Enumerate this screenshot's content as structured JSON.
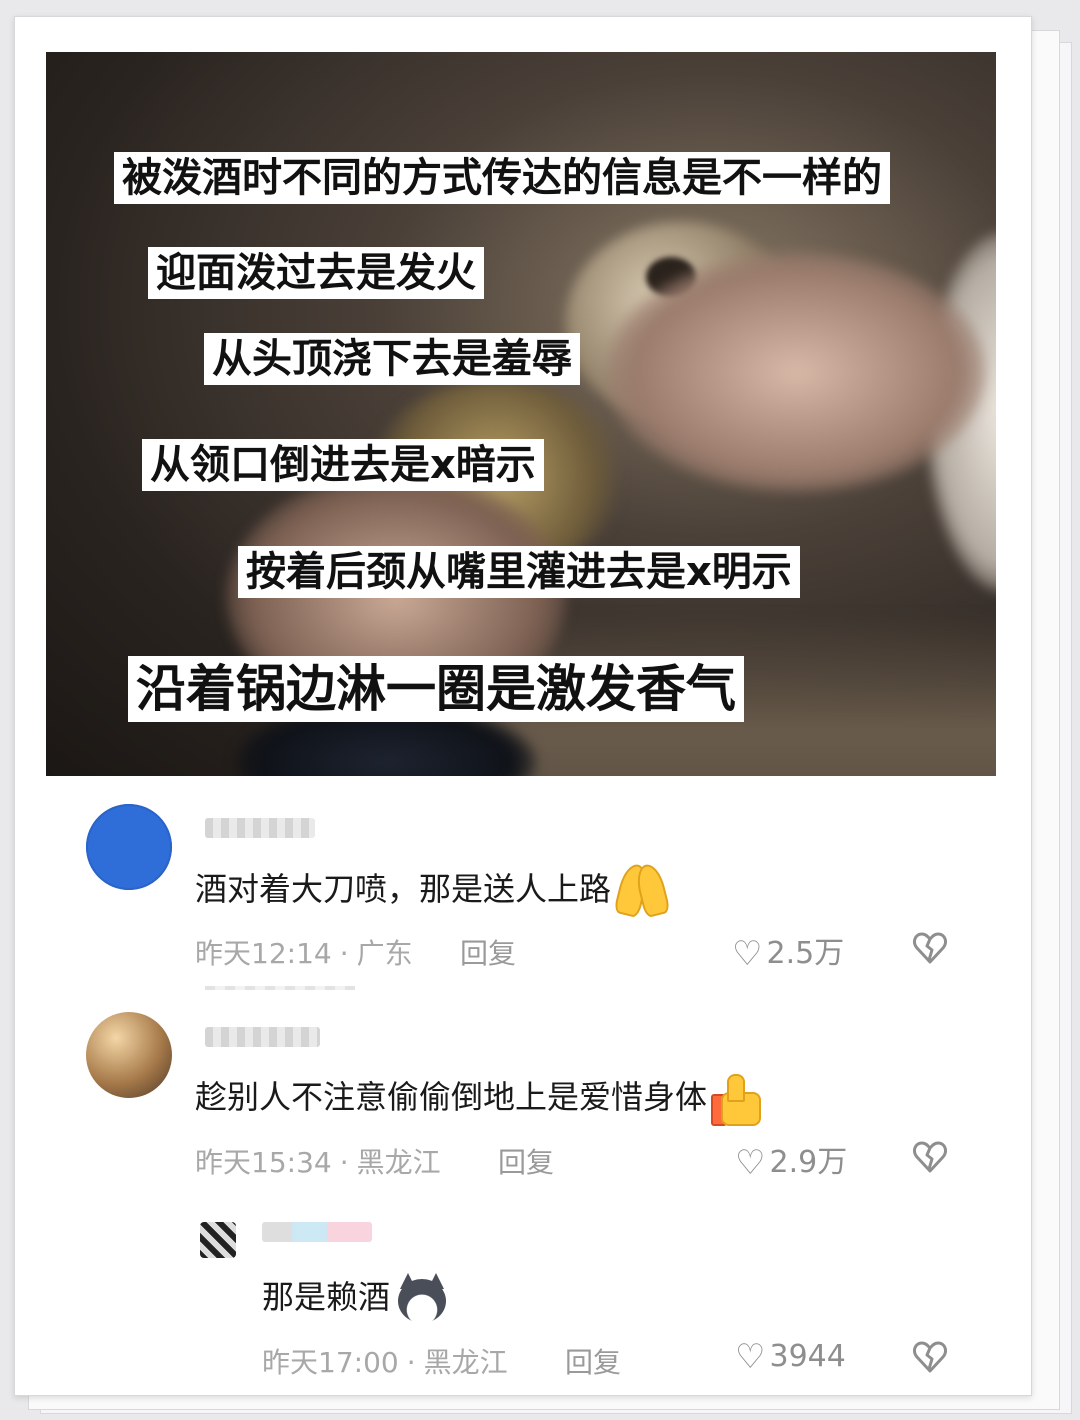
{
  "photo": {
    "captions": [
      "被泼酒时不同的方式传达的信息是不一样的",
      "迎面泼过去是发火",
      "从头顶浇下去是羞辱",
      "从领口倒进去是x暗示",
      "按着后颈从嘴里灌进去是x明示",
      "沿着锅边淋一圈是激发香气"
    ]
  },
  "comments": [
    {
      "text": "酒对着大刀喷，那是送人上路",
      "emoji": "pray-icon",
      "time": "昨天12:14",
      "location": "广东",
      "reply_label": "回复",
      "likes": "2.5万"
    },
    {
      "text": "趁别人不注意偷偷倒地上是爱惜身体",
      "emoji": "thumbs-up-icon",
      "time": "昨天15:34",
      "location": "黑龙江",
      "reply_label": "回复",
      "likes": "2.9万"
    },
    {
      "text": "那是赖酒",
      "emoji": "husky-icon",
      "time": "昨天17:00",
      "location": "黑龙江",
      "reply_label": "回复",
      "likes": "3944"
    }
  ],
  "meta_separator": "·",
  "colors": {
    "caption_bg": "#ffffff",
    "meta_gray": "#a8a8a8",
    "avatar_blue": "#2f6dd8"
  }
}
